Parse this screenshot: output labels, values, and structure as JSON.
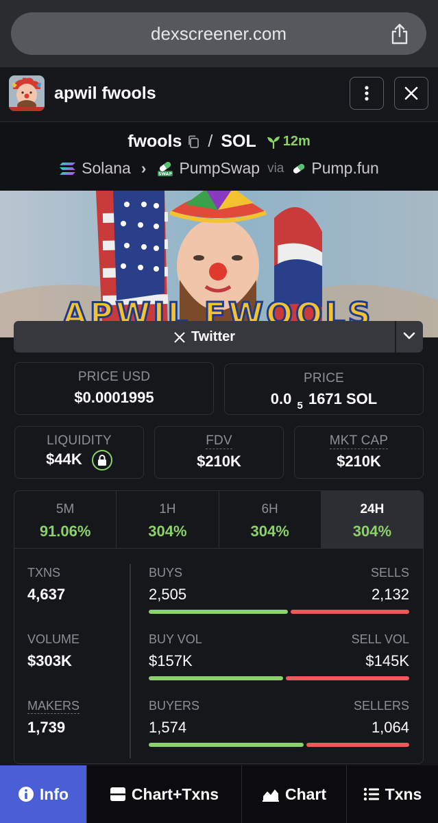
{
  "browser": {
    "url": "dexscreener.com"
  },
  "header": {
    "token_name": "apwil fwools"
  },
  "pair": {
    "base": "fwools",
    "quote": "SOL",
    "age": "12m",
    "chain": "Solana",
    "dex": "PumpSwap",
    "via_label": "via",
    "launchpad": "Pump.fun"
  },
  "banner": {
    "title_text": "APWIL FWOOLS"
  },
  "social": {
    "twitter_label": "Twitter"
  },
  "prices": {
    "usd_label": "PRICE USD",
    "usd_value": "$0.0001995",
    "native_label": "PRICE",
    "native_prefix": "0.0",
    "native_subscript": "5",
    "native_digits": "1671 SOL"
  },
  "stats": {
    "liquidity_label": "LIQUIDITY",
    "liquidity_value": "$44K",
    "fdv_label": "FDV",
    "fdv_value": "$210K",
    "mktcap_label": "MKT CAP",
    "mktcap_value": "$210K"
  },
  "tabs": [
    {
      "label": "5M",
      "value": "91.06%"
    },
    {
      "label": "1H",
      "value": "304%"
    },
    {
      "label": "6H",
      "value": "304%"
    },
    {
      "label": "24H",
      "value": "304%"
    }
  ],
  "activity": {
    "txns_label": "TXNS",
    "txns_value": "4,637",
    "volume_label": "VOLUME",
    "volume_value": "$303K",
    "makers_label": "MAKERS",
    "makers_value": "1,739",
    "buys_label": "BUYS",
    "buys_value": "2,505",
    "sells_label": "SELLS",
    "sells_value": "2,132",
    "buy_vol_label": "BUY VOL",
    "buy_vol_value": "$157K",
    "sell_vol_label": "SELL VOL",
    "sell_vol_value": "$145K",
    "buyers_label": "BUYERS",
    "buyers_value": "1,574",
    "sellers_label": "SELLERS",
    "sellers_value": "1,064"
  },
  "ratios": {
    "buys_fraction": 0.54,
    "buy_vol_fraction": 0.52,
    "buyers_fraction": 0.6
  },
  "nav": {
    "info": "Info",
    "chart_txns": "Chart+Txns",
    "chart": "Chart",
    "txns": "Txns"
  },
  "colors": {
    "green": "#8bd26a",
    "red": "#ee5a5a",
    "accent": "#4a5ed6"
  }
}
